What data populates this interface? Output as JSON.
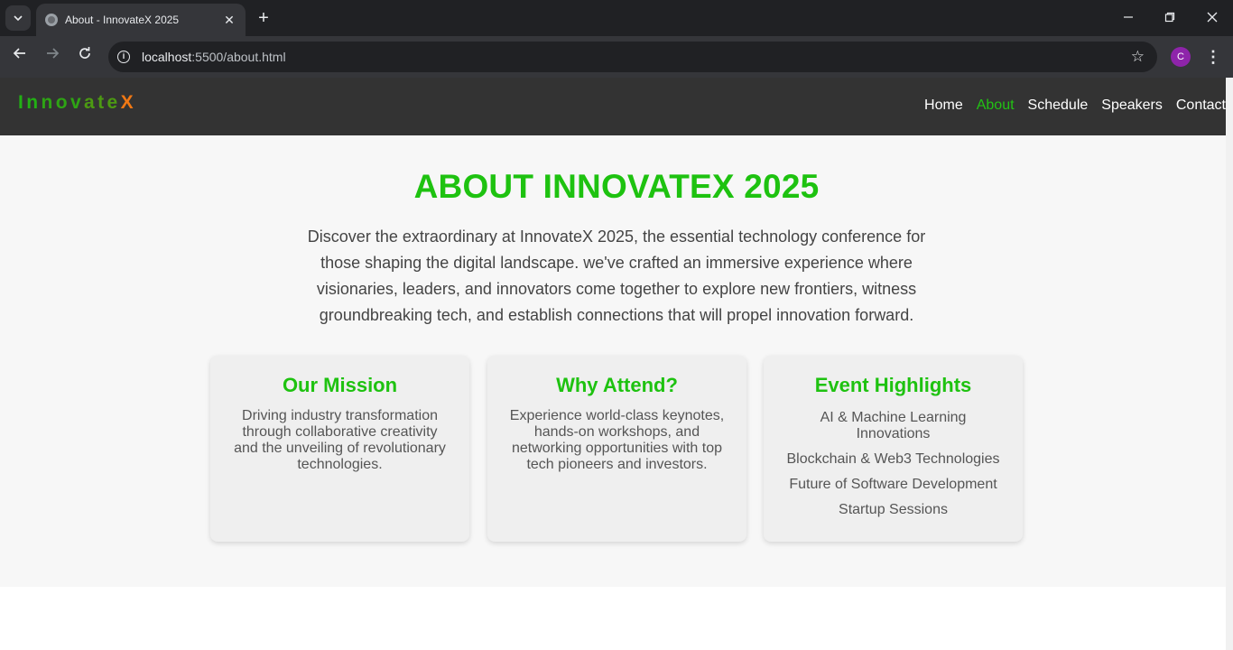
{
  "browser": {
    "tab_title": "About - InnovateX 2025",
    "url_host": "localhost",
    "url_path": ":5500/about.html",
    "profile_initial": "C",
    "icons": {
      "tab_search": "chevron-down-icon",
      "favicon": "globe-icon",
      "close": "close-icon",
      "new_tab": "plus-icon",
      "back": "arrow-left-icon",
      "forward": "arrow-right-icon",
      "reload": "reload-icon",
      "site_info": "info-icon",
      "bookmark": "star-icon",
      "menu": "kebab-menu-icon"
    }
  },
  "header": {
    "logo_letters": [
      "I",
      "n",
      "n",
      "o",
      "v",
      "a",
      "t",
      "e"
    ],
    "logo_x": "X",
    "nav": [
      {
        "label": "Home",
        "active": false
      },
      {
        "label": "About",
        "active": true
      },
      {
        "label": "Schedule",
        "active": false
      },
      {
        "label": "Speakers",
        "active": false
      },
      {
        "label": "Contact",
        "active": false
      }
    ]
  },
  "about": {
    "title": "ABOUT INNOVATEX 2025",
    "intro": "Discover the extraordinary at InnovateX 2025, the essential technology conference for those shaping the digital landscape. we've crafted an immersive experience where visionaries, leaders, and innovators come together to explore new frontiers, witness groundbreaking tech, and establish connections that will propel innovation forward."
  },
  "cards": {
    "mission": {
      "title": "Our Mission",
      "text": "Driving industry transformation through collaborative creativity and the unveiling of revolutionary technologies."
    },
    "why": {
      "title": "Why Attend?",
      "text": "Experience world-class keynotes, hands-on workshops, and networking opportunities with top tech pioneers and investors."
    },
    "highlights": {
      "title": "Event Highlights",
      "items": [
        "AI & Machine Learning Innovations",
        "Blockchain & Web3 Technologies",
        "Future of Software Development",
        "Startup Sessions"
      ]
    }
  },
  "colors": {
    "accent_green": "#1ec210",
    "logo_x_orange": "#f07814",
    "header_bg": "#333333",
    "section_bg": "#f7f7f7",
    "card_bg": "#efefef"
  }
}
